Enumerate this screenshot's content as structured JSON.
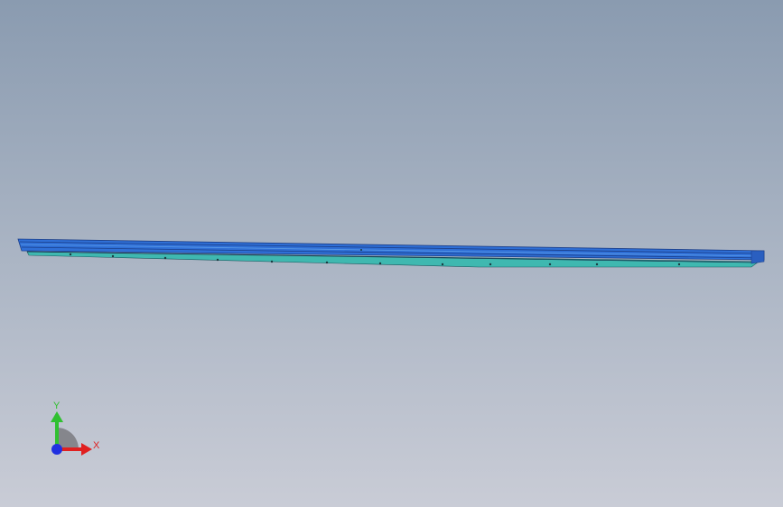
{
  "viewport": {
    "background_top": "#8a9bb0",
    "background_bottom": "#c9ccd6"
  },
  "model": {
    "part_top_color": "#2f6fd6",
    "part_edge_color": "#1b3f8a",
    "part_side_color": "#3fb8b0",
    "hole_color": "#1a3a40"
  },
  "triad": {
    "x_label": "X",
    "y_label": "Y",
    "x_color": "#e02020",
    "y_color": "#30c030",
    "z_color": "#2030e0"
  }
}
